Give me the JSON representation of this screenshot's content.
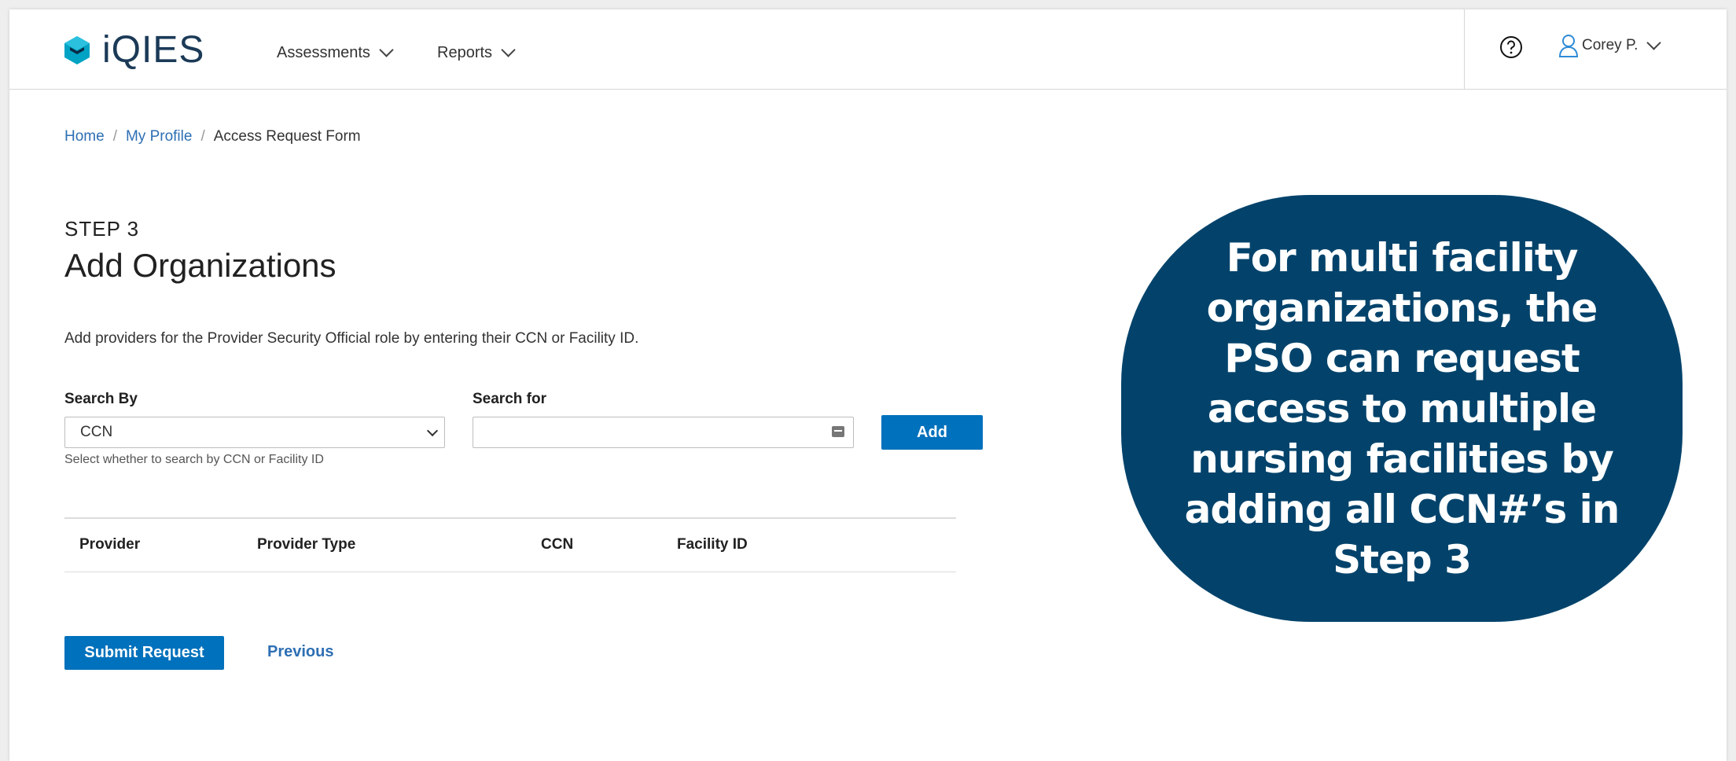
{
  "app": {
    "name": "iQIES",
    "brand_color": "#00a3c4",
    "brand_dark": "#1b3a57"
  },
  "nav": [
    {
      "label": "Assessments"
    },
    {
      "label": "Reports"
    }
  ],
  "user": {
    "name": "Corey P."
  },
  "breadcrumb": {
    "home": "Home",
    "profile": "My Profile",
    "current": "Access Request Form"
  },
  "step": {
    "label": "STEP 3",
    "title": "Add Organizations"
  },
  "description": "Add providers for the Provider Security Official role by entering their CCN or Facility ID.",
  "search": {
    "by_label": "Search By",
    "by_value": "CCN",
    "by_help": "Select whether to search by CCN or Facility ID",
    "for_label": "Search for",
    "for_value": "",
    "add_label": "Add"
  },
  "table": {
    "headers": [
      "Provider",
      "Provider Type",
      "CCN",
      "Facility ID"
    ],
    "rows": []
  },
  "actions": {
    "submit": "Submit Request",
    "previous": "Previous"
  },
  "callout": {
    "text": "For multi facility organizations, the PSO can request access to multiple nursing facilities by adding all CCN#’s in Step 3",
    "background": "#03436b"
  },
  "colors": {
    "primary_button": "#0071bc",
    "link": "#2e6fb3"
  }
}
